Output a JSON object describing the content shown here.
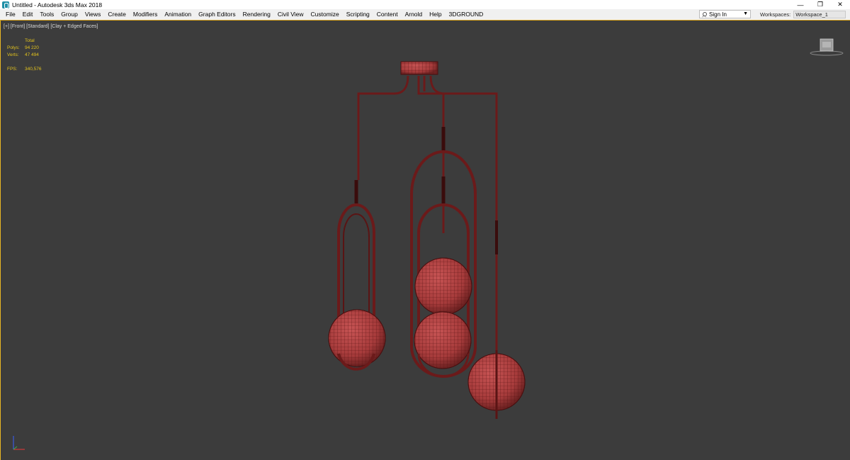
{
  "window": {
    "title": "Untitled - Autodesk 3ds Max 2018",
    "controls": {
      "minimize": "—",
      "restore": "❐",
      "close": "✕"
    }
  },
  "menu": {
    "items": [
      "File",
      "Edit",
      "Tools",
      "Group",
      "Views",
      "Create",
      "Modifiers",
      "Animation",
      "Graph Editors",
      "Rendering",
      "Civil View",
      "Customize",
      "Scripting",
      "Content",
      "Arnold",
      "Help",
      "3DGROUND"
    ],
    "sign_in": "Sign In",
    "workspaces_label": "Workspaces:",
    "workspace_value": "Workspace_1"
  },
  "viewport": {
    "label": "[+] [Front] [Standard] [Clay + Edged Faces]",
    "stats": {
      "header": "Total",
      "polys_label": "Polys:",
      "polys_value": "94 220",
      "verts_label": "Verts:",
      "verts_value": "47 494",
      "fps_label": "FPS:",
      "fps_value": "340,576"
    },
    "viewcube_face": "front"
  },
  "colors": {
    "viewport_bg": "#3c3c3c",
    "active_border": "#e8b724",
    "stats_text": "#e2c21d",
    "mesh_fill": "#b84848",
    "mesh_wire": "#5c1515"
  }
}
